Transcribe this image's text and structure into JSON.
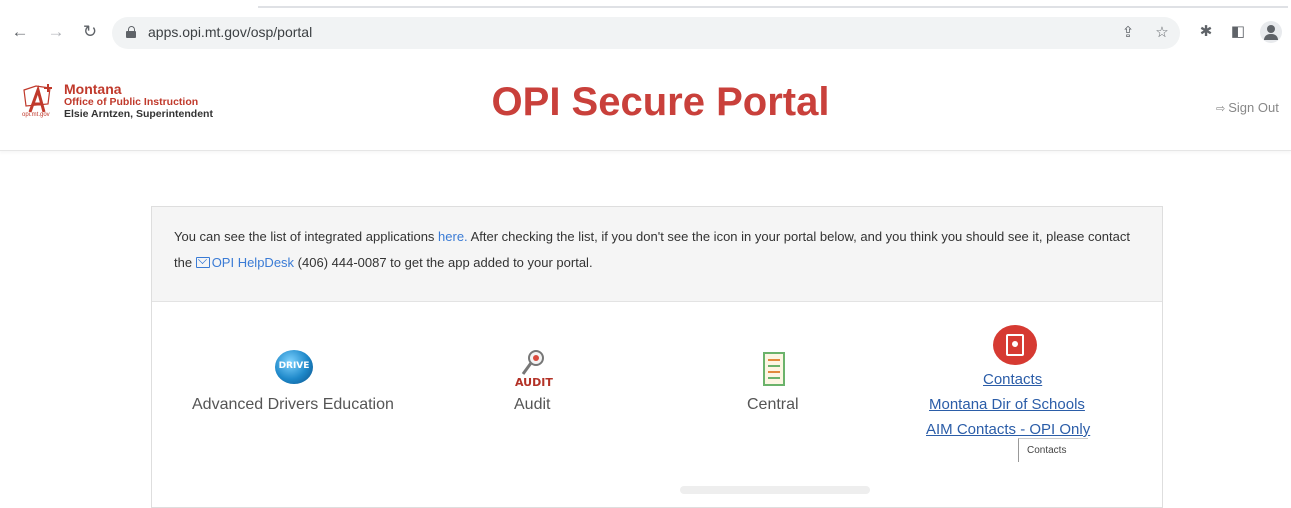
{
  "browser": {
    "url": "apps.opi.mt.gov/osp/portal",
    "back_icon": "arrow-left-icon",
    "forward_icon": "arrow-right-icon",
    "reload_icon": "reload-icon"
  },
  "header": {
    "logo": {
      "name": "Montana",
      "office": "Office of Public Instruction",
      "superintendent": "Elsie Arntzen, Superintendent",
      "small": "opi.mt.gov"
    },
    "title": "OPI Secure Portal",
    "sign_out": "Sign Out"
  },
  "notice": {
    "part1": "You can see the list of integrated applications ",
    "here_link": "here.",
    "part2": " After checking the list, if you don't see the icon in your portal below, and you think you should see it, please contact the ",
    "helpdesk_link": "OPI HelpDesk",
    "part3": " (406) 444-0087 to get the app added to your portal."
  },
  "apps": {
    "drivers": {
      "label": "Advanced Drivers Education",
      "icon_text": "DRIVE"
    },
    "audit": {
      "label": "Audit",
      "icon_text": "AUDIT"
    },
    "central": {
      "label": "Central"
    },
    "contacts": {
      "links": [
        "Contacts",
        "Montana Dir of Schools",
        "AIM Contacts - OPI Only"
      ],
      "tooltip": "Contacts"
    }
  },
  "colors": {
    "brand_red": "#c9403b",
    "link_blue": "#3a7bd5",
    "contacts_link": "#2b5da8"
  }
}
